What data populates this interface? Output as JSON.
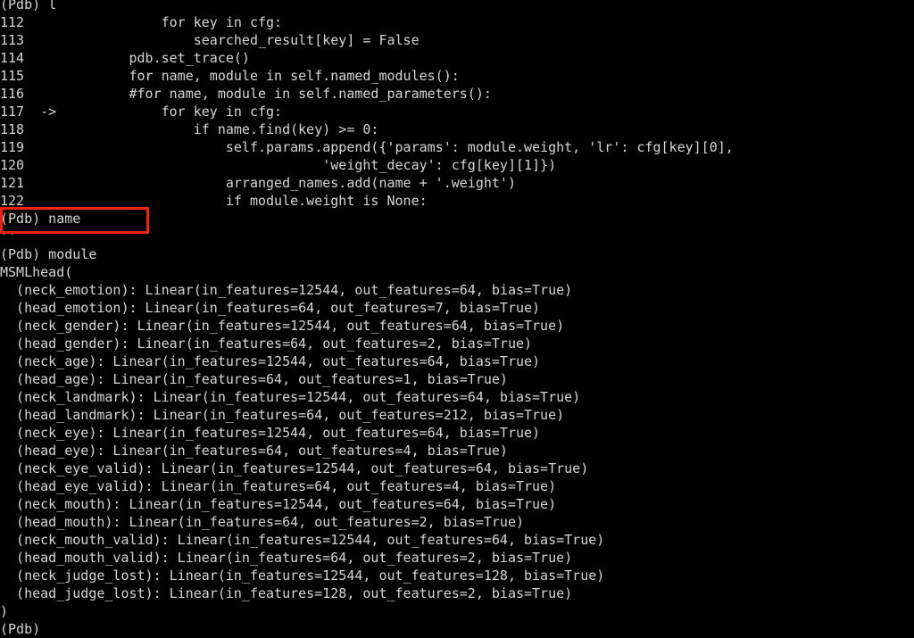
{
  "terminal": {
    "type": "pdb-debugger-session",
    "background_color": "#000000",
    "text_color": "#d6d6d6",
    "highlight_color": "#ee2211",
    "prompt": "(Pdb)",
    "lines": [
      "(Pdb) l",
      "112                 for key in cfg:",
      "113                     searched_result[key] = False",
      "114             pdb.set_trace()",
      "115             for name, module in self.named_modules():",
      "116             #for name, module in self.named_parameters():",
      "117  ->             for key in cfg:",
      "118                     if name.find(key) >= 0:",
      "119                         self.params.append({'params': module.weight, 'lr': cfg[key][0],",
      "120                                     'weight_decay': cfg[key][1]})",
      "121                         arranged_names.add(name + '.weight')",
      "122                         if module.weight is None:",
      "(Pdb) name",
      "''",
      "(Pdb) module",
      "MSMLhead(",
      "  (neck_emotion): Linear(in_features=12544, out_features=64, bias=True)",
      "  (head_emotion): Linear(in_features=64, out_features=7, bias=True)",
      "  (neck_gender): Linear(in_features=12544, out_features=64, bias=True)",
      "  (head_gender): Linear(in_features=64, out_features=2, bias=True)",
      "  (neck_age): Linear(in_features=12544, out_features=64, bias=True)",
      "  (head_age): Linear(in_features=64, out_features=1, bias=True)",
      "  (neck_landmark): Linear(in_features=12544, out_features=64, bias=True)",
      "  (head_landmark): Linear(in_features=64, out_features=212, bias=True)",
      "  (neck_eye): Linear(in_features=12544, out_features=64, bias=True)",
      "  (head_eye): Linear(in_features=64, out_features=4, bias=True)",
      "  (neck_eye_valid): Linear(in_features=12544, out_features=64, bias=True)",
      "  (head_eye_valid): Linear(in_features=64, out_features=4, bias=True)",
      "  (neck_mouth): Linear(in_features=12544, out_features=64, bias=True)",
      "  (head_mouth): Linear(in_features=64, out_features=2, bias=True)",
      "  (neck_mouth_valid): Linear(in_features=12544, out_features=64, bias=True)",
      "  (head_mouth_valid): Linear(in_features=64, out_features=2, bias=True)",
      "  (neck_judge_lost): Linear(in_features=12544, out_features=128, bias=True)",
      "  (head_judge_lost): Linear(in_features=128, out_features=2, bias=True)",
      ")",
      "(Pdb)"
    ],
    "highlight": {
      "label": "pdb-name-command-highlight",
      "lines": [
        "(Pdb) name",
        "''"
      ]
    }
  }
}
